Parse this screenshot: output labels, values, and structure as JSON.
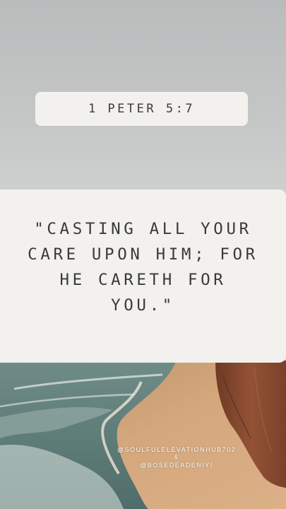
{
  "reference": "1 PETER 5:7",
  "quote": "\"CASTING ALL YOUR\nCARE UPON HIM; FOR\nHE CARETH FOR\nYOU.\"",
  "credits": {
    "handle_1": "@SOULFULELEVATIONHUB702",
    "separator": "&",
    "handle_2": "@BOSEDEADENIYI"
  },
  "colors": {
    "card_background": "#f2f1ed",
    "text": "#3a3a3a",
    "sky": "#c6c9c8",
    "sand": "#d3a57a",
    "cliff": "#8a4a2e",
    "sea": "#5f7d78"
  }
}
